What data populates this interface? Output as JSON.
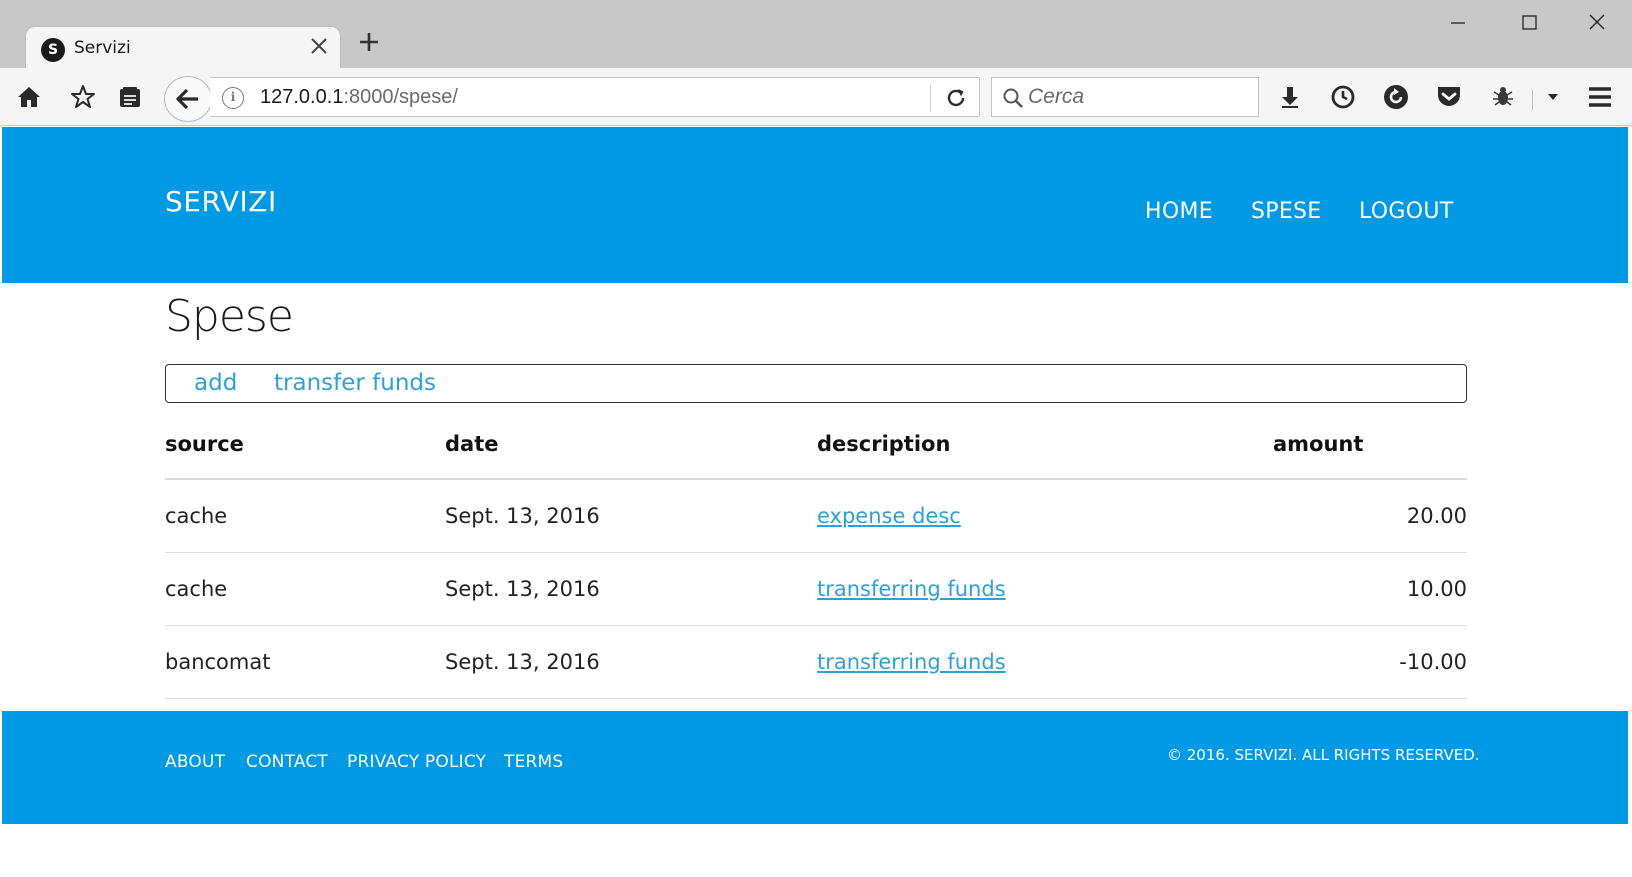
{
  "browser": {
    "tab_title": "Servizi",
    "tab_favicon_letter": "S",
    "new_tab_label": "+",
    "url_host": "127.0.0.1",
    "url_path": ":8000/spese/",
    "search_placeholder": "Cerca",
    "info_glyph": "i"
  },
  "header": {
    "brand": "SERVIZI",
    "nav": [
      "HOME",
      "SPESE",
      "LOGOUT"
    ]
  },
  "main": {
    "title": "Spese",
    "actions": [
      "add",
      "transfer funds"
    ],
    "table": {
      "headers": [
        "source",
        "date",
        "description",
        "amount"
      ],
      "rows": [
        {
          "source": "cache",
          "date": "Sept. 13, 2016",
          "description": "expense desc",
          "amount": "20.00"
        },
        {
          "source": "cache",
          "date": "Sept. 13, 2016",
          "description": "transferring funds",
          "amount": "10.00"
        },
        {
          "source": "bancomat",
          "date": "Sept. 13, 2016",
          "description": "transferring funds",
          "amount": "-10.00"
        }
      ]
    }
  },
  "footer": {
    "links": [
      "ABOUT",
      "CONTACT",
      "PRIVACY POLICY",
      "TERMS"
    ],
    "copyright": "© 2016. SERVIZI. ALL RIGHTS RESERVED."
  },
  "colors": {
    "brand_blue": "#009ae4",
    "link_blue": "#2f9fd8"
  }
}
